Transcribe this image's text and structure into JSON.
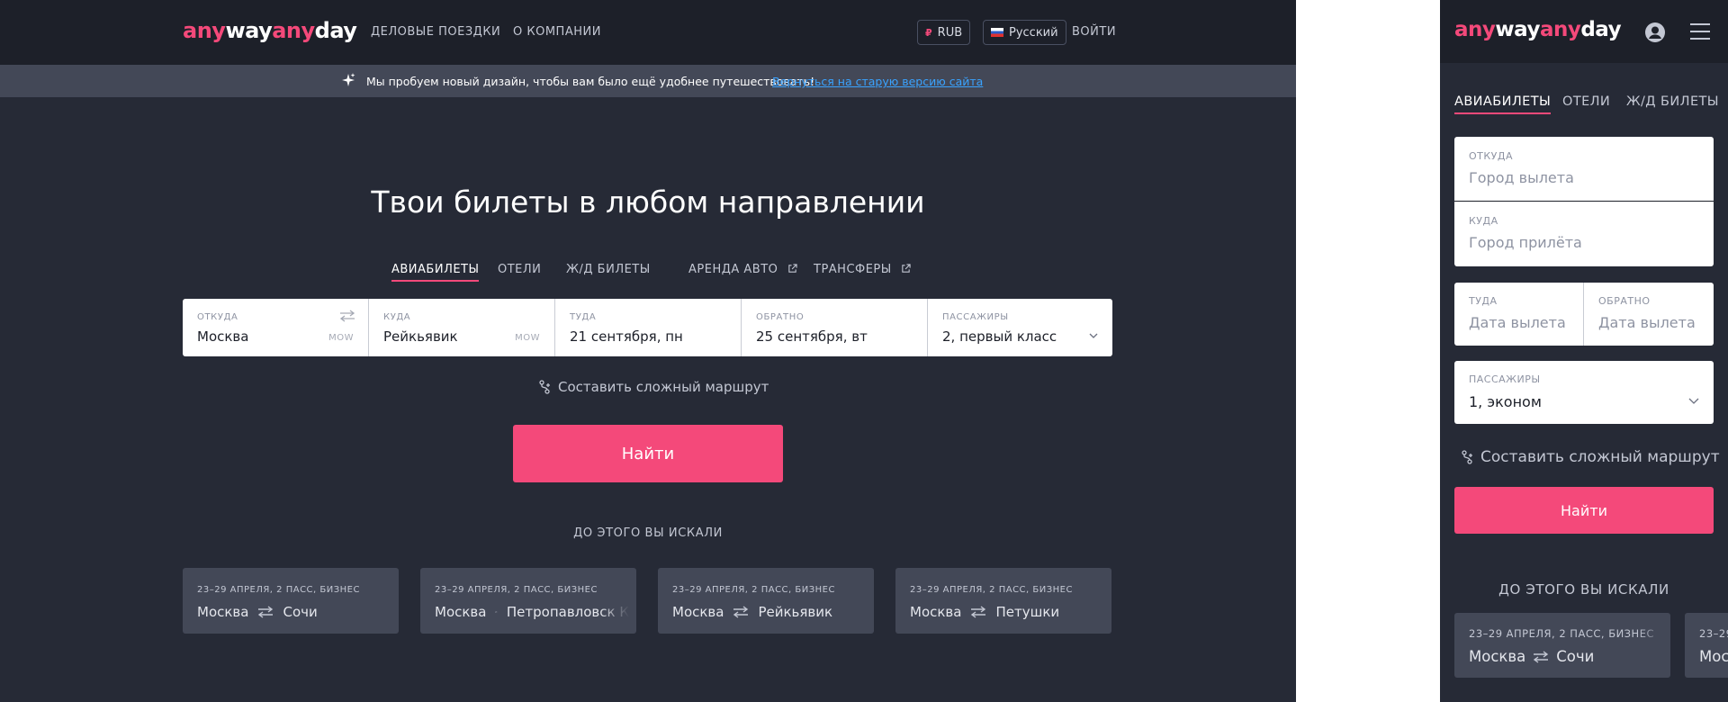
{
  "brand": {
    "part1": "any",
    "part2": "way",
    "part3": "any",
    "part4": "day"
  },
  "colors": {
    "accent": "#f4497a",
    "header_bg": "#1d2029",
    "page_bg": "#262a36",
    "card_bg": "#434857",
    "link": "#3aa3ff"
  },
  "desktop": {
    "nav": {
      "business": "ДЕЛОВЫЕ ПОЕЗДКИ",
      "about": "О КОМПАНИИ"
    },
    "currency": {
      "symbol": "₽",
      "code": "RUB"
    },
    "language": "Русский",
    "login": "ВОЙТИ",
    "banner": {
      "text": "Мы пробуем новый дизайн, чтобы вам было ещё удобнее путешествовать!",
      "link": "Вернуться на старую версию сайта"
    },
    "hero_title": "Твои билеты в любом направлении",
    "tabs": {
      "flights": "АВИАБИЛЕТЫ",
      "hotels": "ОТЕЛИ",
      "rail": "Ж/Д БИЛЕТЫ",
      "cars": "АРЕНДА АВТО",
      "transfers": "ТРАНСФЕРЫ"
    },
    "search": {
      "from_label": "ОТКУДА",
      "from_value": "Москва",
      "from_code": "MOW",
      "to_label": "КУДА",
      "to_value": "Рейкьявик",
      "to_code": "MOW",
      "depart_label": "ТУДА",
      "depart_value": "21 сентября, пн",
      "return_label": "ОБРАТНО",
      "return_value": "25 сентября, вт",
      "pax_label": "ПАССАЖИРЫ",
      "pax_value": "2, первый класс"
    },
    "complex_route": "Составить сложный маршрут",
    "find": "Найти",
    "history_title": "ДО ЭТОГО ВЫ ИСКАЛИ",
    "history": [
      {
        "date": "23–29 АПРЕЛЯ, 2 ПАСС, БИЗНЕС",
        "from": "Москва",
        "to": "Сочи"
      },
      {
        "date": "23–29 АПРЕЛЯ, 2 ПАСС, БИЗНЕС",
        "from": "Москва",
        "to": "Петропавловск К"
      },
      {
        "date": "23–29 АПРЕЛЯ, 2 ПАСС, БИЗНЕС",
        "from": "Москва",
        "to": "Рейкьявик"
      },
      {
        "date": "23–29 АПРЕЛЯ, 2 ПАСС, БИЗНЕС",
        "from": "Москва",
        "to": "Петушки"
      }
    ]
  },
  "mobile": {
    "tabs": {
      "flights": "АВИАБИЛЕТЫ",
      "hotels": "ОТЕЛИ",
      "rail": "Ж/Д БИЛЕТЫ"
    },
    "from_label": "ОТКУДА",
    "from_placeholder": "Город вылета",
    "to_label": "КУДА",
    "to_placeholder": "Город прилёта",
    "depart_label": "ТУДА",
    "depart_placeholder": "Дата вылета",
    "return_label": "ОБРАТНО",
    "return_placeholder": "Дата вылета",
    "pax_label": "ПАССАЖИРЫ",
    "pax_value": "1, эконом",
    "complex_route": "Составить сложный маршрут",
    "find": "Найти",
    "history_title": "ДО ЭТОГО ВЫ ИСКАЛИ",
    "history": [
      {
        "date": "23–29 АПРЕЛЯ, 2 ПАСС, БИЗНЕС",
        "from": "Москва",
        "to": "Сочи"
      },
      {
        "date": "23–29 А",
        "from": "Мос"
      }
    ]
  }
}
